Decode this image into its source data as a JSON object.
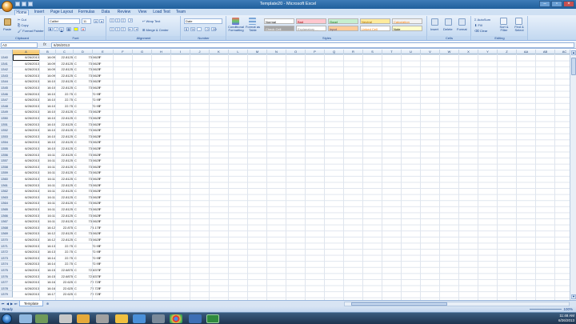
{
  "window": {
    "title": "Template20 - Microsoft Excel"
  },
  "tabs": [
    "Home",
    "Insert",
    "Page Layout",
    "Formulas",
    "Data",
    "Review",
    "View",
    "Load Test",
    "Team"
  ],
  "ribbon": {
    "clipboard": {
      "paste": "Paste",
      "cut": "Cut",
      "copy": "Copy",
      "format_painter": "Format Painter",
      "label": "Clipboard"
    },
    "font": {
      "name": "Calibri",
      "size": "11",
      "label": "Font"
    },
    "alignment": {
      "wrap": "Wrap Text",
      "merge": "Merge & Center",
      "label": "Alignment"
    },
    "number": {
      "format": "Date",
      "symbol": "$",
      "percent": "%",
      "label": "Number"
    },
    "styles": {
      "conditional": "Conditional Formatting",
      "format_table": "Format as Table",
      "cells": [
        {
          "text": "Normal",
          "bg": "#ffffff",
          "fg": "#000000"
        },
        {
          "text": "Bad",
          "bg": "#ffc7ce",
          "fg": "#9c0006"
        },
        {
          "text": "Good",
          "bg": "#c6efce",
          "fg": "#006100"
        },
        {
          "text": "Neutral",
          "bg": "#ffeb9c",
          "fg": "#9c6500"
        },
        {
          "text": "Calculation",
          "bg": "#f2f2f2",
          "fg": "#fa7d00"
        },
        {
          "text": "Check Cell",
          "bg": "#a5a5a5",
          "fg": "#ffffff"
        },
        {
          "text": "Explanatory ...",
          "bg": "#ffffff",
          "fg": "#7f7f7f"
        },
        {
          "text": "Input",
          "bg": "#ffcc99",
          "fg": "#3f3f76"
        },
        {
          "text": "Linked Cell",
          "bg": "#ffffff",
          "fg": "#fa7d00"
        },
        {
          "text": "Note",
          "bg": "#ffffcc",
          "fg": "#000000"
        }
      ],
      "label": "Styles"
    },
    "cells": {
      "insert": "Insert",
      "delete": "Delete",
      "format": "Format",
      "label": "Cells"
    },
    "editing": {
      "autosum": "AutoSum",
      "fill": "Fill",
      "clear": "Clear",
      "sort": "Sort & Filter",
      "find": "Find & Select",
      "label": "Editing"
    }
  },
  "formula_bar": {
    "name_box": "A3",
    "fx": "fx",
    "content": "6/26/2013"
  },
  "columns": [
    "A",
    "B",
    "C",
    "D",
    "E",
    "F",
    "G",
    "H",
    "I",
    "J",
    "K",
    "L",
    "M",
    "N",
    "O",
    "P",
    "Q",
    "R",
    "S",
    "T",
    "U",
    "V",
    "W",
    "X",
    "Y",
    "Z",
    "AA",
    "AB",
    "AC"
  ],
  "rows": [
    [
      "1340",
      "6/26/2013",
      "16:09",
      "22.8125",
      "C",
      "73.0625",
      "F"
    ],
    [
      "1341",
      "6/26/2013",
      "16:09",
      "22.8125",
      "C",
      "73.0625",
      "F"
    ],
    [
      "1342",
      "6/26/2013",
      "16:09",
      "22.8125",
      "C",
      "73.0625",
      "F"
    ],
    [
      "1343",
      "6/26/2013",
      "16:09",
      "22.8125",
      "C",
      "73.0625",
      "F"
    ],
    [
      "1344",
      "6/26/2013",
      "16:10",
      "22.8125",
      "C",
      "73.0625",
      "F"
    ],
    [
      "1345",
      "6/26/2013",
      "16:10",
      "22.8125",
      "C",
      "73.0625",
      "F"
    ],
    [
      "1346",
      "6/26/2013",
      "16:10",
      "22.75",
      "C",
      "72.95",
      "F"
    ],
    [
      "1347",
      "6/26/2013",
      "16:10",
      "22.75",
      "C",
      "72.95",
      "F"
    ],
    [
      "1348",
      "6/26/2013",
      "16:10",
      "22.75",
      "C",
      "72.95",
      "F"
    ],
    [
      "1349",
      "6/26/2013",
      "16:10",
      "22.8125",
      "C",
      "73.0625",
      "F"
    ],
    [
      "1350",
      "6/26/2013",
      "16:10",
      "22.8125",
      "C",
      "73.0625",
      "F"
    ],
    [
      "1351",
      "6/26/2013",
      "16:10",
      "22.8125",
      "C",
      "73.0625",
      "F"
    ],
    [
      "1352",
      "6/26/2013",
      "16:10",
      "22.8125",
      "C",
      "73.0625",
      "F"
    ],
    [
      "1353",
      "6/26/2013",
      "16:10",
      "22.8125",
      "C",
      "73.0625",
      "F"
    ],
    [
      "1354",
      "6/26/2013",
      "16:10",
      "22.8125",
      "C",
      "73.0625",
      "F"
    ],
    [
      "1355",
      "6/26/2013",
      "16:10",
      "22.8125",
      "C",
      "73.0625",
      "F"
    ],
    [
      "1356",
      "6/26/2013",
      "16:11",
      "22.8125",
      "C",
      "73.0625",
      "F"
    ],
    [
      "1357",
      "6/26/2013",
      "16:11",
      "22.8125",
      "C",
      "73.0625",
      "F"
    ],
    [
      "1358",
      "6/26/2013",
      "16:11",
      "22.8125",
      "C",
      "73.0625",
      "F"
    ],
    [
      "1359",
      "6/26/2013",
      "16:11",
      "22.8125",
      "C",
      "73.0625",
      "F"
    ],
    [
      "1360",
      "6/26/2013",
      "16:11",
      "22.8125",
      "C",
      "73.0625",
      "F"
    ],
    [
      "1361",
      "6/26/2013",
      "16:11",
      "22.8125",
      "C",
      "73.0625",
      "F"
    ],
    [
      "1362",
      "6/26/2013",
      "16:11",
      "22.8125",
      "C",
      "73.0625",
      "F"
    ],
    [
      "1363",
      "6/26/2013",
      "16:11",
      "22.8125",
      "C",
      "73.0625",
      "F"
    ],
    [
      "1364",
      "6/26/2013",
      "16:11",
      "22.8125",
      "C",
      "73.0625",
      "F"
    ],
    [
      "1365",
      "6/26/2013",
      "16:11",
      "22.8125",
      "C",
      "73.0625",
      "F"
    ],
    [
      "1366",
      "6/26/2013",
      "16:11",
      "22.8125",
      "C",
      "73.0625",
      "F"
    ],
    [
      "1367",
      "6/26/2013",
      "16:11",
      "22.8125",
      "C",
      "73.0625",
      "F"
    ],
    [
      "1368",
      "6/26/2013",
      "16:12",
      "22.875",
      "C",
      "73.175",
      "F"
    ],
    [
      "1369",
      "6/26/2013",
      "16:12",
      "22.8125",
      "C",
      "73.0625",
      "F"
    ],
    [
      "1370",
      "6/26/2013",
      "16:12",
      "22.8125",
      "C",
      "73.0625",
      "F"
    ],
    [
      "1371",
      "6/26/2013",
      "16:13",
      "22.75",
      "C",
      "72.95",
      "F"
    ],
    [
      "1372",
      "6/26/2013",
      "16:13",
      "22.75",
      "C",
      "72.95",
      "F"
    ],
    [
      "1373",
      "6/26/2013",
      "16:14",
      "22.75",
      "C",
      "72.95",
      "F"
    ],
    [
      "1374",
      "6/26/2013",
      "16:14",
      "22.75",
      "C",
      "72.95",
      "F"
    ],
    [
      "1375",
      "6/26/2013",
      "16:15",
      "22.6875",
      "C",
      "72.8375",
      "F"
    ],
    [
      "1376",
      "6/26/2013",
      "16:15",
      "22.6875",
      "C",
      "72.8375",
      "F"
    ],
    [
      "1377",
      "6/26/2013",
      "16:16",
      "22.625",
      "C",
      "72.725",
      "F"
    ],
    [
      "1378",
      "6/26/2013",
      "16:16",
      "22.625",
      "C",
      "72.725",
      "F"
    ],
    [
      "1379",
      "6/26/2013",
      "16:17",
      "22.625",
      "C",
      "72.725",
      "F"
    ]
  ],
  "sheet_tab": "Template",
  "status": {
    "ready": "Ready",
    "zoom": "100%"
  },
  "taskbar": {
    "time": "11:48 AM",
    "date": "6/26/2013"
  }
}
